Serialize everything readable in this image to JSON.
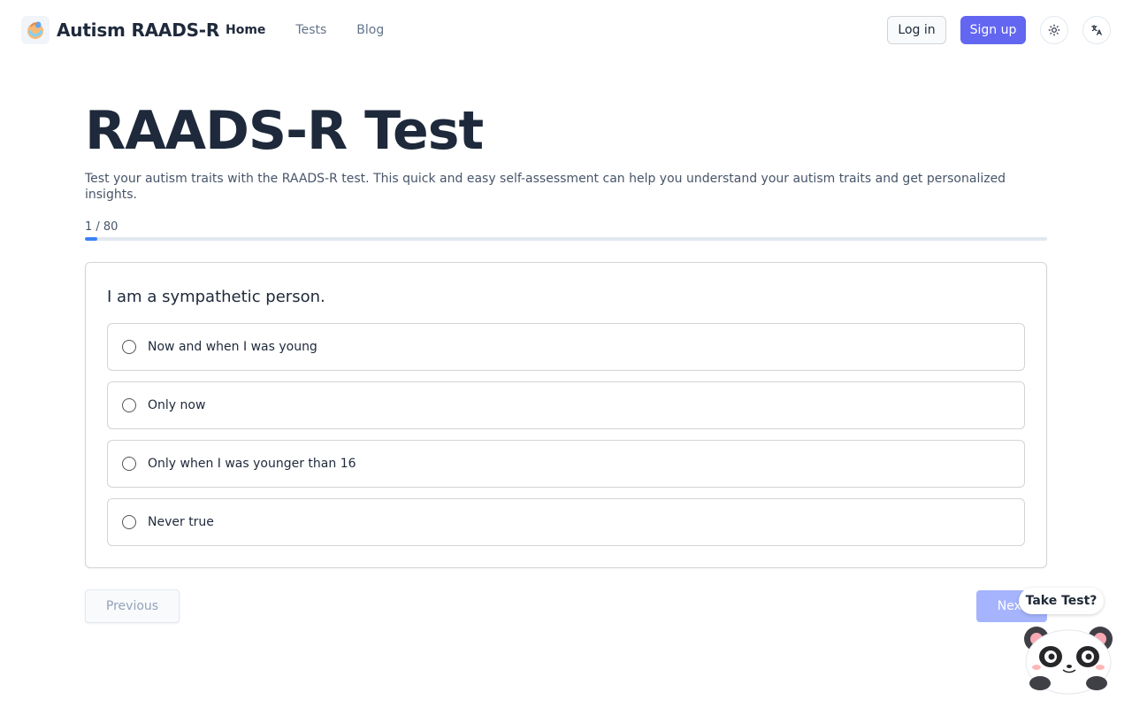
{
  "brand": {
    "name": "Autism RAADS-R"
  },
  "nav": {
    "home": "Home",
    "tests": "Tests",
    "blog": "Blog"
  },
  "auth": {
    "login": "Log in",
    "signup": "Sign up"
  },
  "page": {
    "title": "RAADS-R Test",
    "subtitle": "Test your autism traits with the RAADS-R test. This quick and easy self-assessment can help you understand your autism traits and get personalized insights."
  },
  "progress": {
    "label": "1 / 80",
    "current": 1,
    "total": 80
  },
  "question": {
    "text": "I am a sympathetic person.",
    "options": [
      "Now and when I was young",
      "Only now",
      "Only when I was younger than 16",
      "Never true"
    ]
  },
  "controls": {
    "previous": "Previous",
    "next": "Next"
  },
  "mascot": {
    "bubble": "Take Test?"
  },
  "colors": {
    "accent": "#6366f1",
    "progress": "#3b82f6",
    "next_disabled": "#a5b4fc"
  }
}
